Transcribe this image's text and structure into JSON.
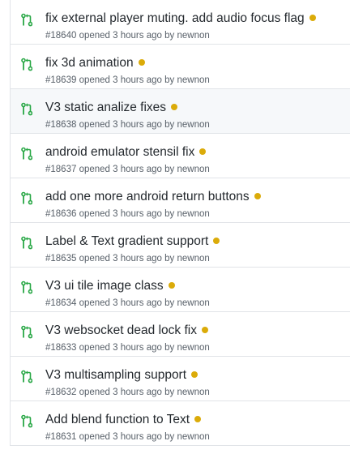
{
  "colors": {
    "open_pr_icon": "#28a745",
    "status_pending": "#dbab09",
    "meta_text": "#586069",
    "title_text": "#24292e"
  },
  "icons": {
    "pull_request": "git-pull-request-icon"
  },
  "pull_requests": [
    {
      "title": "fix external player muting. add audio focus flag",
      "number": "#18640",
      "opened": "opened",
      "time": "3 hours ago",
      "by": "by",
      "author": "newnon",
      "status": "pending"
    },
    {
      "title": "fix 3d animation",
      "number": "#18639",
      "opened": "opened",
      "time": "3 hours ago",
      "by": "by",
      "author": "newnon",
      "status": "pending"
    },
    {
      "title": "V3 static analize fixes",
      "number": "#18638",
      "opened": "opened",
      "time": "3 hours ago",
      "by": "by",
      "author": "newnon",
      "status": "pending"
    },
    {
      "title": "android emulator stensil fix",
      "number": "#18637",
      "opened": "opened",
      "time": "3 hours ago",
      "by": "by",
      "author": "newnon",
      "status": "pending"
    },
    {
      "title": "add one more android return buttons",
      "number": "#18636",
      "opened": "opened",
      "time": "3 hours ago",
      "by": "by",
      "author": "newnon",
      "status": "pending"
    },
    {
      "title": "Label & Text gradient support",
      "number": "#18635",
      "opened": "opened",
      "time": "3 hours ago",
      "by": "by",
      "author": "newnon",
      "status": "pending"
    },
    {
      "title": "V3 ui tile image class",
      "number": "#18634",
      "opened": "opened",
      "time": "3 hours ago",
      "by": "by",
      "author": "newnon",
      "status": "pending"
    },
    {
      "title": "V3 websocket dead lock fix",
      "number": "#18633",
      "opened": "opened",
      "time": "3 hours ago",
      "by": "by",
      "author": "newnon",
      "status": "pending"
    },
    {
      "title": "V3 multisampling support",
      "number": "#18632",
      "opened": "opened",
      "time": "3 hours ago",
      "by": "by",
      "author": "newnon",
      "status": "pending"
    },
    {
      "title": "Add blend function to Text",
      "number": "#18631",
      "opened": "opened",
      "time": "3 hours ago",
      "by": "by",
      "author": "newnon",
      "status": "pending"
    }
  ]
}
